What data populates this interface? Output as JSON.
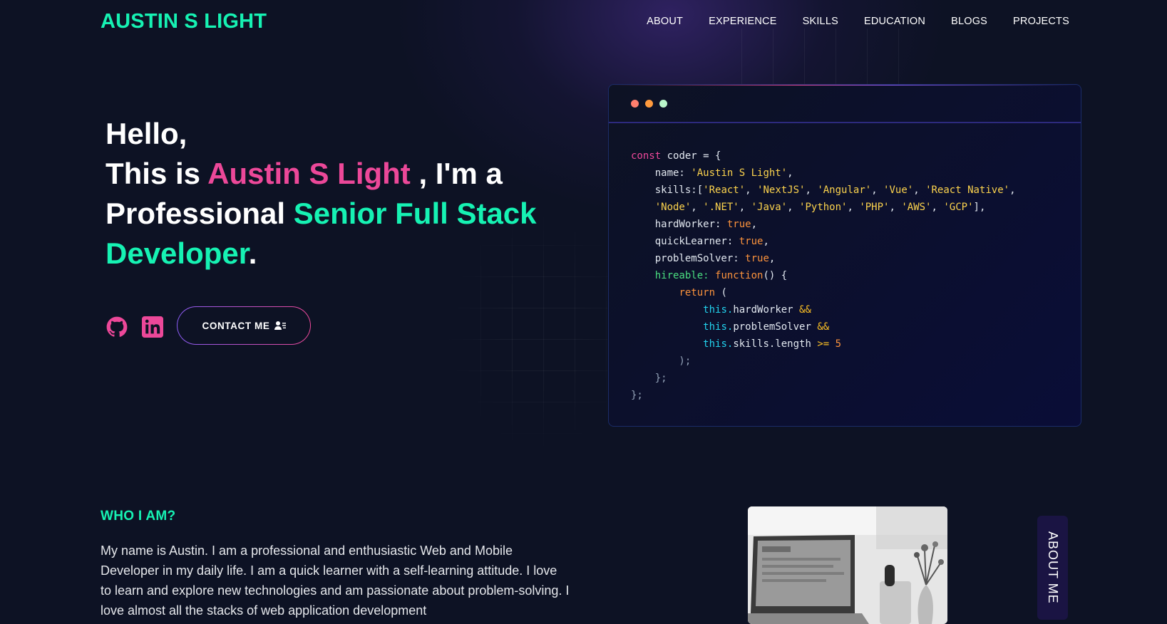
{
  "nav": {
    "logo": "AUSTIN S LIGHT",
    "items": [
      {
        "label": "ABOUT"
      },
      {
        "label": "EXPERIENCE"
      },
      {
        "label": "SKILLS"
      },
      {
        "label": "EDUCATION"
      },
      {
        "label": "BLOGS"
      },
      {
        "label": "PROJECTS"
      }
    ]
  },
  "hero": {
    "greeting": "Hello,",
    "intro_prefix": "This is ",
    "name": "Austin S Light",
    "intro_suffix": " , I'm a",
    "professional": "Professional ",
    "role": "Senior Full Stack Developer",
    "period": ".",
    "social": [
      {
        "icon": "github-icon"
      },
      {
        "icon": "linkedin-icon"
      }
    ],
    "contact_label": "CONTACT ME",
    "contact_icon": "user-contact-icon"
  },
  "code_window": {
    "dots": [
      "#ff7f6e",
      "#ff9a3d",
      "#b9f6ca"
    ],
    "lines": {
      "l1_kw": "const",
      "l1_rest": " coder = {",
      "name_key": "name: ",
      "name_val": "'Austin S Light'",
      "skills_key": "skills:[",
      "skills_1": [
        "'React'",
        "'NextJS'",
        "'Angular'",
        "'Vue'",
        "'React Native'"
      ],
      "skills_2": [
        "'Node'",
        "'.NET'",
        "'Java'",
        "'Python'",
        "'PHP'",
        "'AWS'",
        "'GCP'"
      ],
      "hard_key": "hardWorker: ",
      "quick_key": "quickLearner: ",
      "problem_key": "problemSolver: ",
      "true_val": "true",
      "hireable_key": "hireable: ",
      "function_kw": "function",
      "return_kw": "return",
      "this_kw": "this",
      "prop_hard": "hardWorker",
      "prop_problem": "problemSolver",
      "prop_skills": "skills.length",
      "op_and": "&&",
      "op_gte": ">=",
      "num_5": "5"
    }
  },
  "about": {
    "title": "WHO I AM?",
    "text": "My name is Austin. I am a professional and enthusiastic Web and Mobile Developer in my daily life. I am a quick learner with a self-learning attitude. I love to learn and explore new technologies and am passionate about problem-solving. I love almost all the stacks of web application development",
    "badge": "ABOUT ME"
  },
  "colors": {
    "accent_green": "#16f2b3",
    "accent_pink": "#ec4899",
    "background": "#0d1224"
  }
}
